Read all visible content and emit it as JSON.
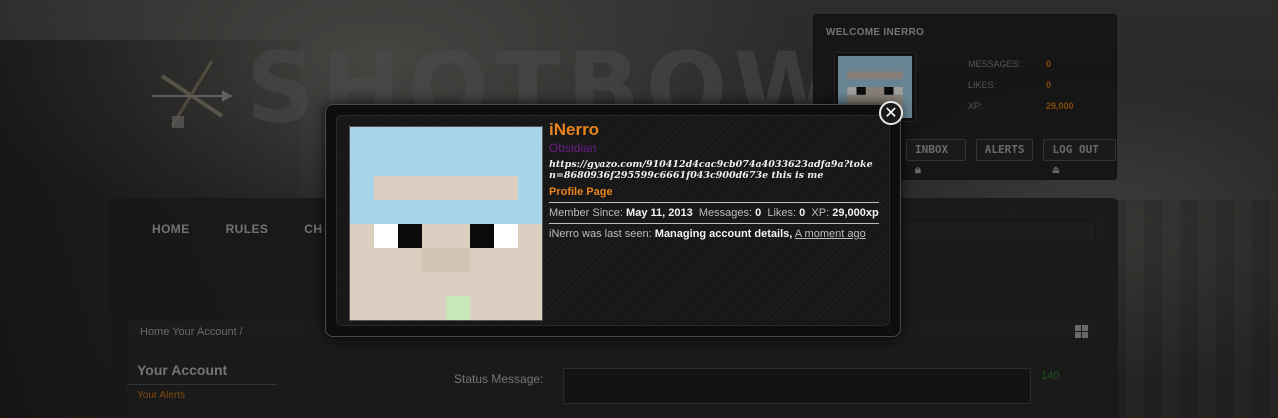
{
  "site": {
    "logo_text": "SHOTBOW"
  },
  "welcome": {
    "title": "WELCOME INERRO",
    "stats": [
      {
        "label": "MESSAGES:",
        "value": "0"
      },
      {
        "label": "LIKES:",
        "value": "0"
      },
      {
        "label": "XP:",
        "value": "29,000"
      }
    ],
    "buttons": {
      "inbox": "INBOX",
      "alerts": "ALERTS",
      "logout": "LOG OUT"
    }
  },
  "nav": {
    "home": "HOME",
    "rules": "RULES",
    "partial": "CH"
  },
  "breadcrumb": {
    "text": "Home  Your Account /"
  },
  "sidebar": {
    "title": "Your Account",
    "link": "Your Alerts"
  },
  "status_form": {
    "label": "Status Message:",
    "counter": "140"
  },
  "popup": {
    "username": "iNerro",
    "rank": "Obsidian",
    "status_message": "https://gyazo.com/910412d4cac9cb074a4033623adfa9a?token=8680936f295599c6661f043c900d673e this is me",
    "profile_link": "Profile Page",
    "member_since_label": "Member Since:",
    "member_since_value": "May 11, 2013",
    "messages_label": "Messages:",
    "messages_value": "0",
    "likes_label": "Likes:",
    "likes_value": "0",
    "xp_label": "XP:",
    "xp_value": "29,000xp",
    "last_seen_prefix": "iNerro was last seen:",
    "last_seen_activity": "Managing account details,",
    "last_seen_time": "A moment ago",
    "close_glyph": "✕"
  },
  "colors": {
    "accent_orange": "#e8841c",
    "rank_purple": "#6a1f86",
    "skin_sky": "#a8d4ea",
    "skin_face": "#dccfc2",
    "skin_green": "#c9e8b8"
  }
}
